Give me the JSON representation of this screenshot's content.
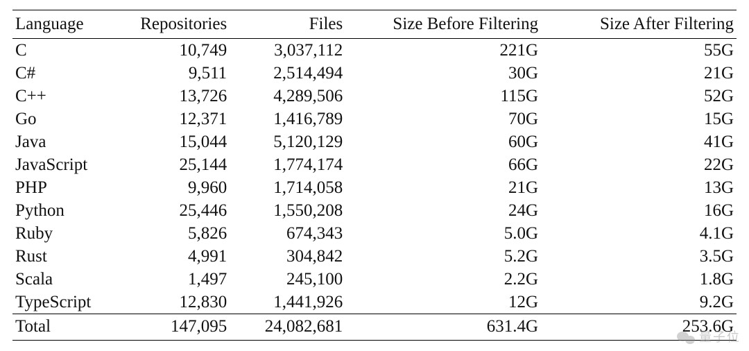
{
  "chart_data": {
    "type": "table",
    "headers": [
      "Language",
      "Repositories",
      "Files",
      "Size Before Filtering",
      "Size After Filtering"
    ],
    "rows": [
      {
        "language": "C",
        "repositories": "10,749",
        "files": "3,037,112",
        "size_before": "221G",
        "size_after": "55G"
      },
      {
        "language": "C#",
        "repositories": "9,511",
        "files": "2,514,494",
        "size_before": "30G",
        "size_after": "21G"
      },
      {
        "language": "C++",
        "repositories": "13,726",
        "files": "4,289,506",
        "size_before": "115G",
        "size_after": "52G"
      },
      {
        "language": "Go",
        "repositories": "12,371",
        "files": "1,416,789",
        "size_before": "70G",
        "size_after": "15G"
      },
      {
        "language": "Java",
        "repositories": "15,044",
        "files": "5,120,129",
        "size_before": "60G",
        "size_after": "41G"
      },
      {
        "language": "JavaScript",
        "repositories": "25,144",
        "files": "1,774,174",
        "size_before": "66G",
        "size_after": "22G"
      },
      {
        "language": "PHP",
        "repositories": "9,960",
        "files": "1,714,058",
        "size_before": "21G",
        "size_after": "13G"
      },
      {
        "language": "Python",
        "repositories": "25,446",
        "files": "1,550,208",
        "size_before": "24G",
        "size_after": "16G"
      },
      {
        "language": "Ruby",
        "repositories": "5,826",
        "files": "674,343",
        "size_before": "5.0G",
        "size_after": "4.1G"
      },
      {
        "language": "Rust",
        "repositories": "4,991",
        "files": "304,842",
        "size_before": "5.2G",
        "size_after": "3.5G"
      },
      {
        "language": "Scala",
        "repositories": "1,497",
        "files": "245,100",
        "size_before": "2.2G",
        "size_after": "1.8G"
      },
      {
        "language": "TypeScript",
        "repositories": "12,830",
        "files": "1,441,926",
        "size_before": "12G",
        "size_after": "9.2G"
      }
    ],
    "total": {
      "language": "Total",
      "repositories": "147,095",
      "files": "24,082,681",
      "size_before": "631.4G",
      "size_after": "253.6G"
    }
  },
  "watermark": "量子位"
}
